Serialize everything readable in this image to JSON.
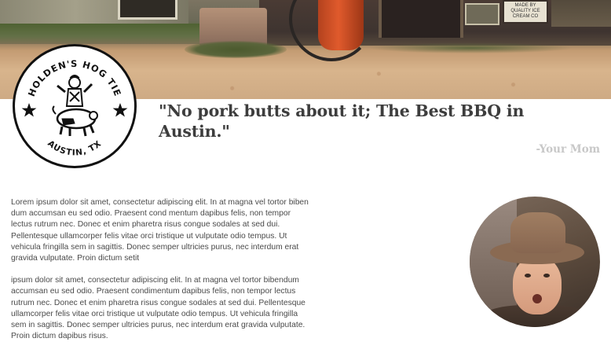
{
  "logo": {
    "top_text": "HOLDEN'S HOG TIE",
    "bottom_text": "AUSTIN, TX"
  },
  "hero": {
    "sign_text": "MADE BY QUALITY ICE CREAM CO"
  },
  "quote": {
    "text": "\"No pork butts about it; The Best BBQ in Austin.\"",
    "attribution": "-Your Mom"
  },
  "body": {
    "paragraphs": [
      "Lorem ipsum dolor sit amet, consectetur adipiscing elit. In at magna vel tortor biben dum accumsan eu sed odio. Praesent cond mentum dapibus felis, non tempor lectus rutrum nec. Donec et enim pharetra risus congue sodales at sed dui. Pellentesque ullamcorper felis vitae orci tristique ut vulputate odio tempus. Ut vehicula fringilla sem in sagittis. Donec semper ultricies purus, nec interdum erat gravida vulputate. Proin dictum setit",
      "ipsum dolor sit amet, consectetur adipiscing elit. In at magna vel tortor bibendum accumsan eu sed odio. Praesent condimentum dapibus felis, non tempor lectus rutrum nec. Donec et enim pharetra risus congue sodales at sed dui. Pellentesque ullamcorper felis vitae orci tristique ut vulputate odio tempus. Ut vehicula fringilla sem in sagittis. Donec semper ultricies purus, nec interdum erat gravida vulputate. Proin dictum dapibus risus."
    ]
  },
  "colors": {
    "quote": "#3d3d3d",
    "attribution": "#c8c8c8",
    "body": "#4a4a4a",
    "logo_ink": "#111111"
  },
  "icons": [
    "star-icon",
    "hog-rider-illustration"
  ]
}
